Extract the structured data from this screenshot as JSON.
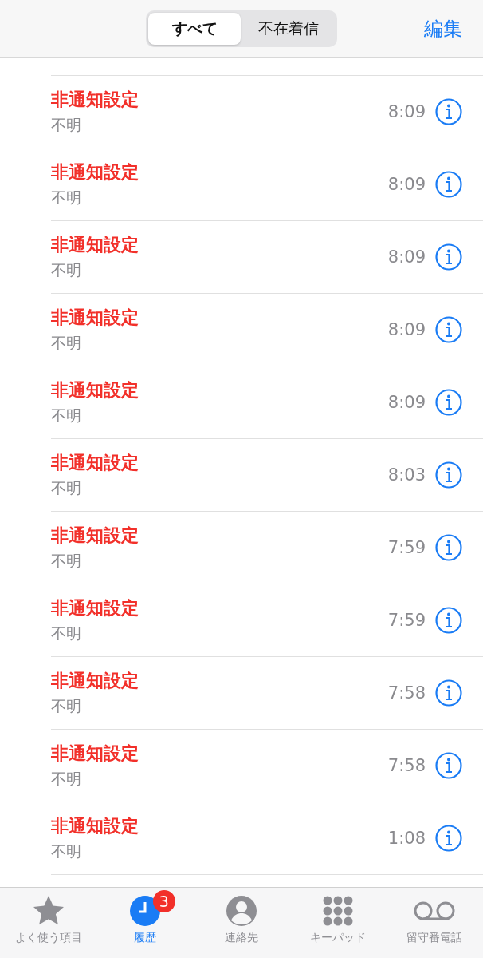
{
  "header": {
    "segments": [
      {
        "label": "すべて",
        "selected": true
      },
      {
        "label": "不在着信",
        "selected": false
      }
    ],
    "edit": "編集"
  },
  "calls": [
    {
      "name": "非通知設定",
      "type": "不明",
      "time": "8:09",
      "missed": true
    },
    {
      "name": "非通知設定",
      "type": "不明",
      "time": "8:09",
      "missed": true
    },
    {
      "name": "非通知設定",
      "type": "不明",
      "time": "8:09",
      "missed": true
    },
    {
      "name": "非通知設定",
      "type": "不明",
      "time": "8:09",
      "missed": true
    },
    {
      "name": "非通知設定",
      "type": "不明",
      "time": "8:09",
      "missed": true
    },
    {
      "name": "非通知設定",
      "type": "不明",
      "time": "8:03",
      "missed": true
    },
    {
      "name": "非通知設定",
      "type": "不明",
      "time": "7:59",
      "missed": true
    },
    {
      "name": "非通知設定",
      "type": "不明",
      "time": "7:59",
      "missed": true
    },
    {
      "name": "非通知設定",
      "type": "不明",
      "time": "7:58",
      "missed": true
    },
    {
      "name": "非通知設定",
      "type": "不明",
      "time": "7:58",
      "missed": true
    },
    {
      "name": "非通知設定",
      "type": "不明",
      "time": "1:08",
      "missed": true
    }
  ],
  "tab_bar": [
    {
      "kind": "favorites",
      "label": "よく使う項目",
      "selected": false
    },
    {
      "kind": "recents",
      "label": "履歴",
      "selected": true,
      "badge": "3"
    },
    {
      "kind": "contacts",
      "label": "連絡先",
      "selected": false
    },
    {
      "kind": "keypad",
      "label": "キーパッド",
      "selected": false
    },
    {
      "kind": "voicemail",
      "label": "留守番電話",
      "selected": false
    }
  ]
}
